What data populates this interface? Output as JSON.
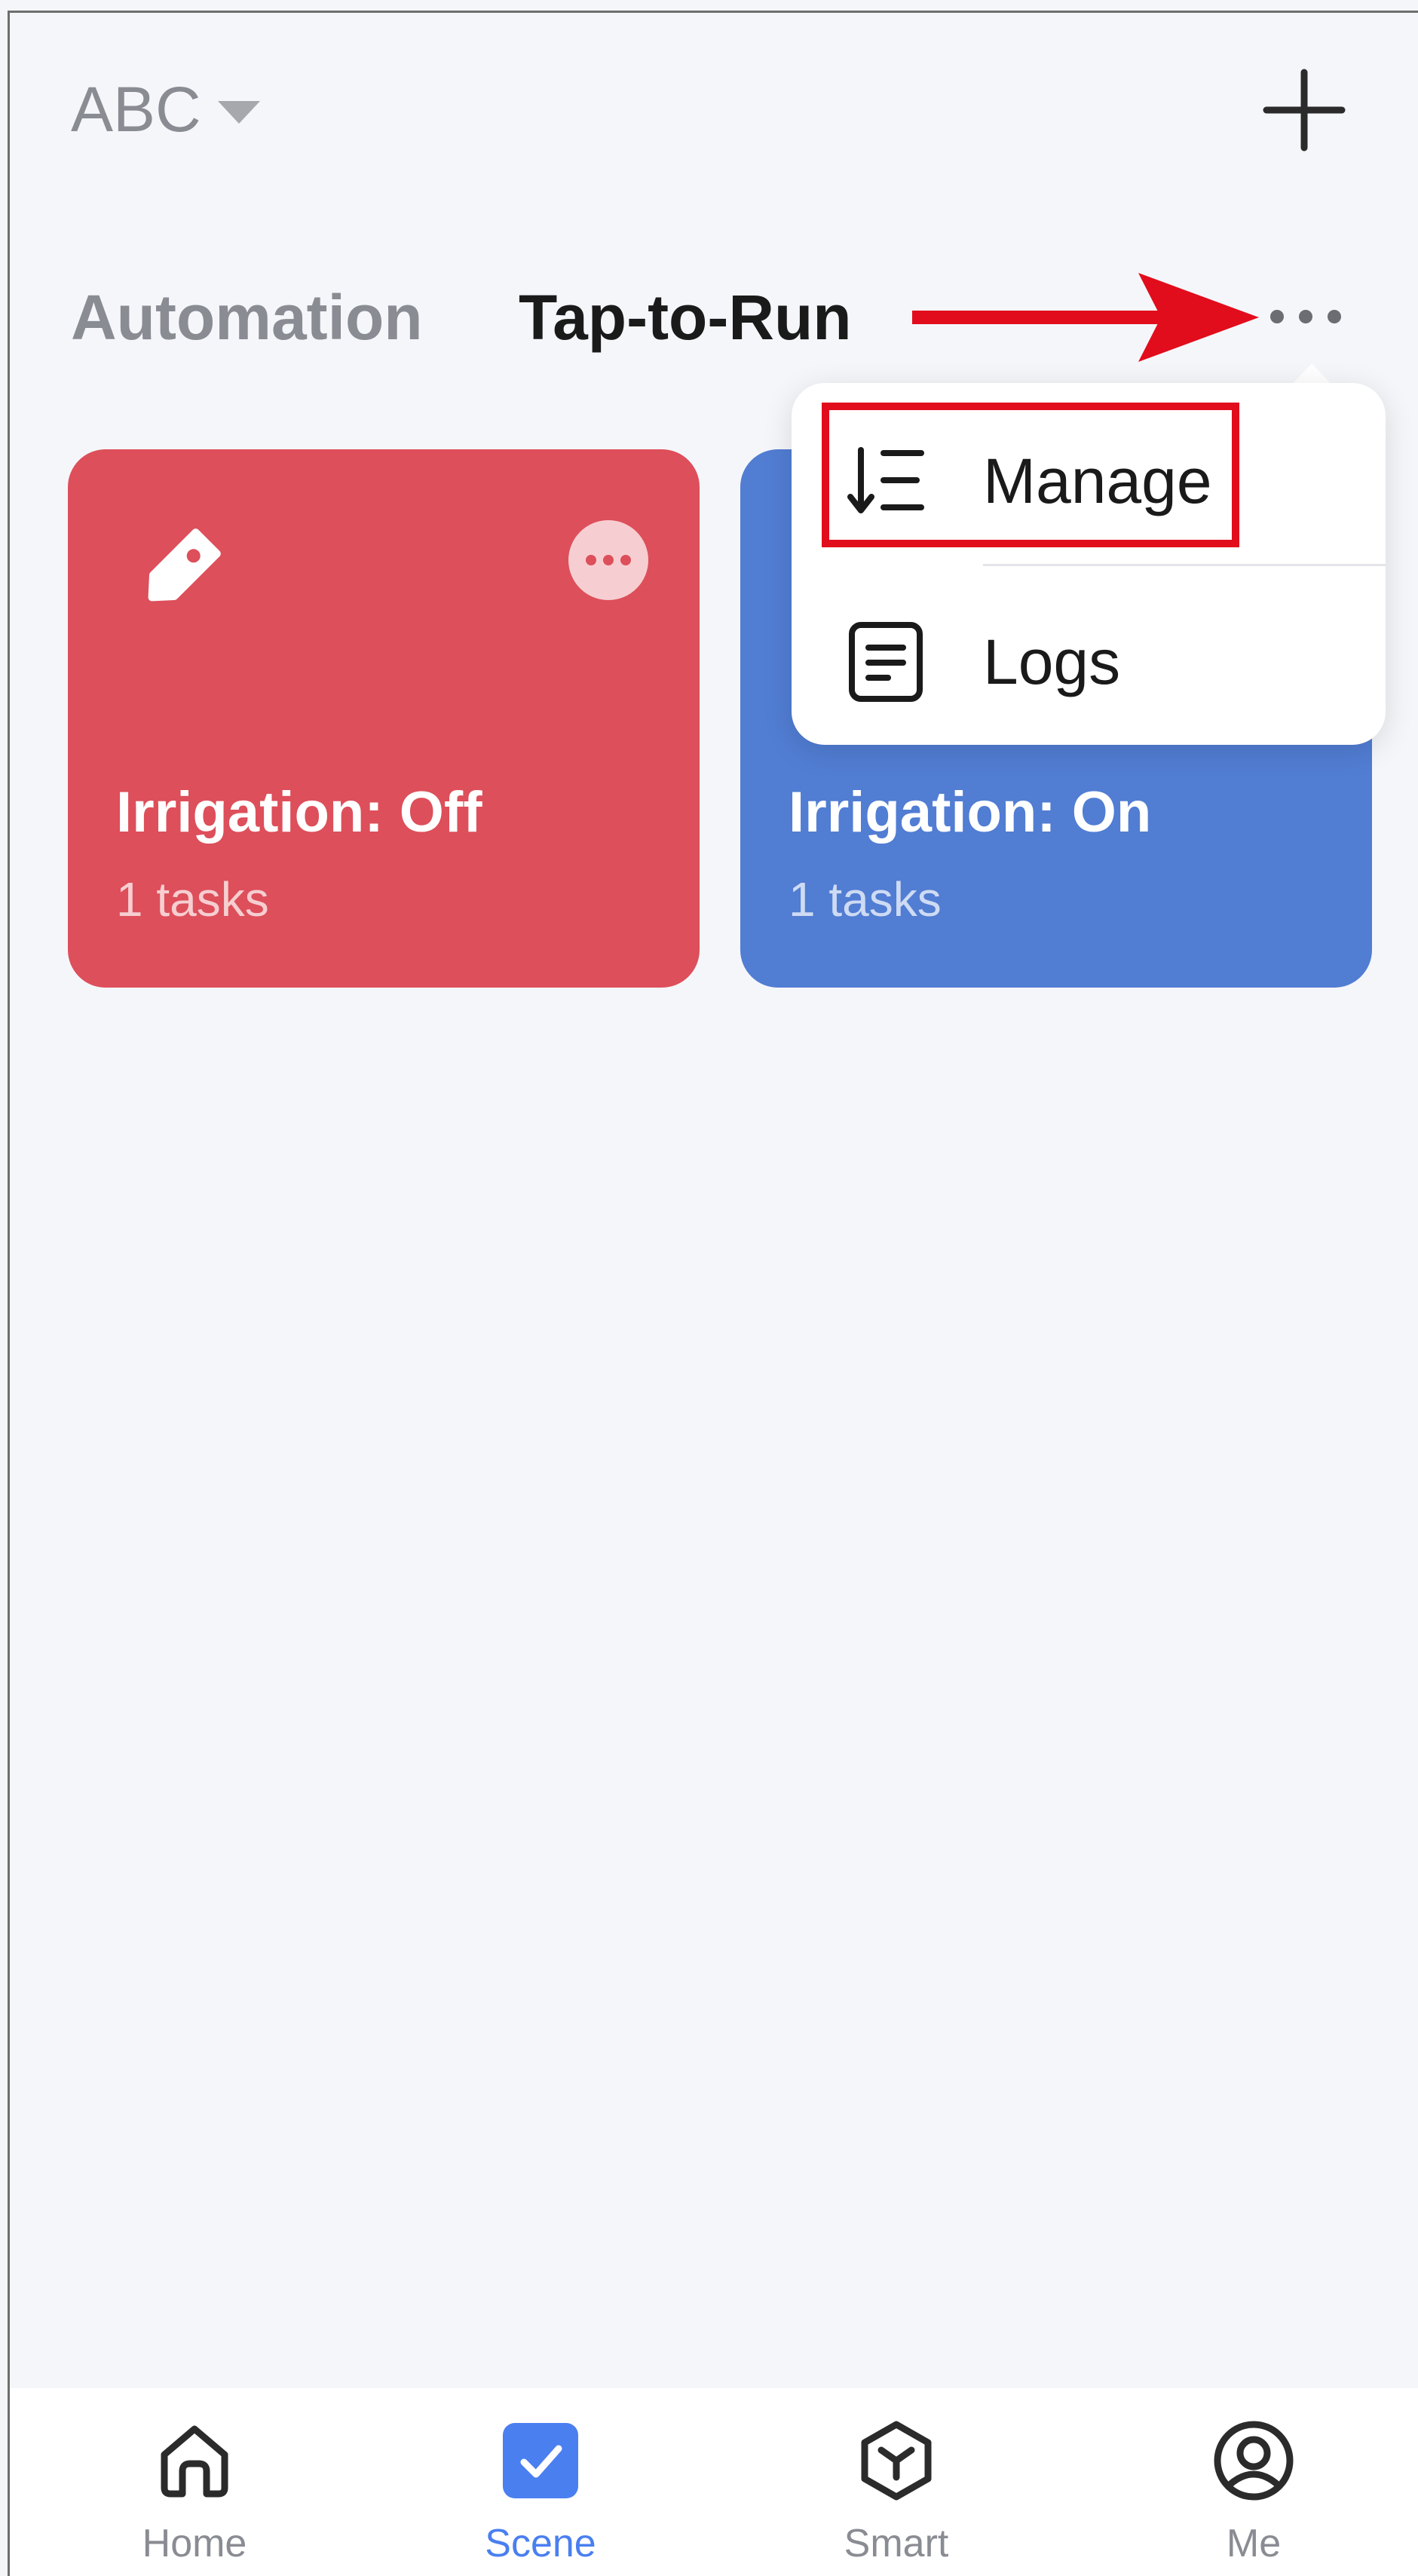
{
  "header": {
    "home_name": "ABC",
    "dropdown_icon": "caret-down-icon",
    "add_icon": "plus-icon"
  },
  "tabs": {
    "automation_label": "Automation",
    "tap_to_run_label": "Tap-to-Run",
    "active_tab": "Tap-to-Run",
    "more_icon": "more-horizontal-icon"
  },
  "scenes": [
    {
      "title": "Irrigation: Off",
      "subtitle": "1 tasks",
      "color": "#dd4f5a",
      "icon": "tag-icon"
    },
    {
      "title": "Irrigation: On",
      "subtitle": "1 tasks",
      "color": "#517dd3"
    }
  ],
  "popup_menu": {
    "items": [
      {
        "label": "Manage",
        "icon": "sort-list-icon",
        "highlighted": true
      },
      {
        "label": "Logs",
        "icon": "document-icon"
      }
    ]
  },
  "bottom_nav": {
    "items": [
      {
        "label": "Home",
        "icon": "home-icon",
        "active": false
      },
      {
        "label": "Scene",
        "icon": "scene-check-icon",
        "active": true
      },
      {
        "label": "Smart",
        "icon": "cube-icon",
        "active": false
      },
      {
        "label": "Me",
        "icon": "user-circle-icon",
        "active": false
      }
    ]
  },
  "colors": {
    "background": "#f5f6fa",
    "accent": "#4a7ff0",
    "annotation_red": "#e10d1c",
    "inactive_text": "#8a8c93"
  }
}
